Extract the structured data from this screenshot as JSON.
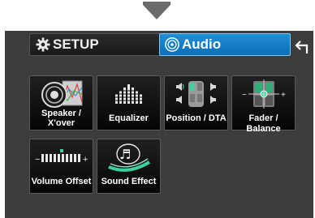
{
  "header": {
    "setup_label": "SETUP",
    "audio_label": "Audio"
  },
  "tiles": [
    {
      "label_line1": "Speaker /",
      "label_line2": "X'over",
      "icon": "speaker-icon"
    },
    {
      "label": "Equalizer",
      "icon": "equalizer-icon"
    },
    {
      "label": "Position / DTA",
      "icon": "position-icon"
    },
    {
      "label": "Fader / Balance",
      "icon": "fader-balance-icon"
    },
    {
      "label": "Volume Offset",
      "icon": "volume-offset-icon"
    },
    {
      "label": "Sound Effect",
      "icon": "sound-effect-icon"
    }
  ],
  "colors": {
    "accent": "#1b86cc",
    "screen_bg": "#3d3d3d",
    "tile_bg": "#111111"
  }
}
